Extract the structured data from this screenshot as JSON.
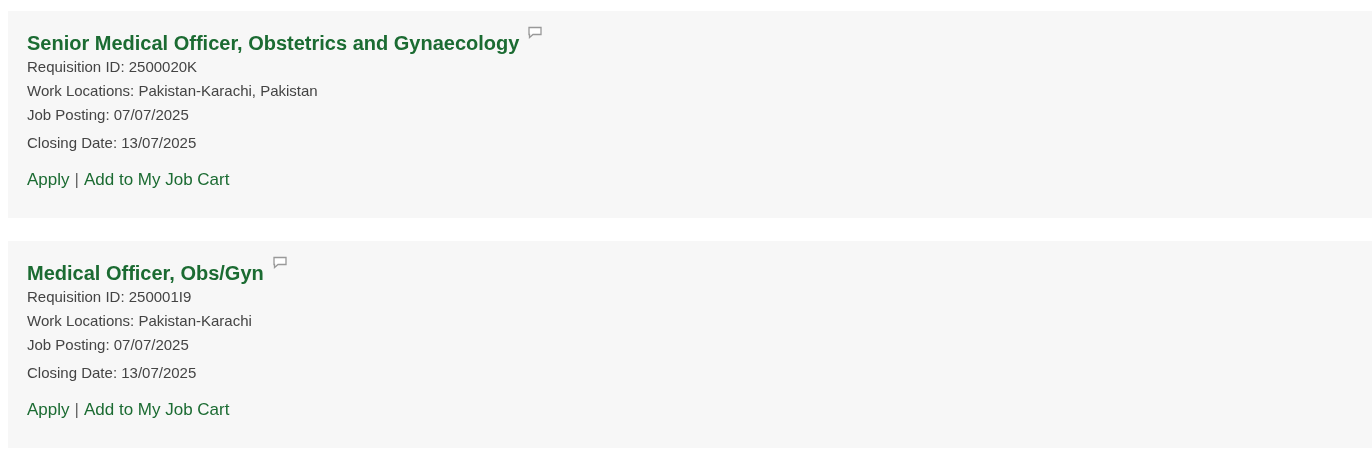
{
  "jobs": [
    {
      "title": "Senior Medical Officer, Obstetrics and Gynaecology",
      "details": [
        "Requisition ID: 2500020K",
        "Work Locations: Pakistan-Karachi, Pakistan",
        "Job Posting: 07/07/2025",
        "Closing Date: 13/07/2025"
      ],
      "links": [
        "Apply",
        "Add to My Job Cart"
      ],
      "separator": "|"
    },
    {
      "title": "Medical Officer, Obs/Gyn",
      "details": [
        "Requisition ID: 250001I9",
        "Work Locations: Pakistan-Karachi",
        "Job Posting: 07/07/2025",
        "Closing Date: 13/07/2025"
      ],
      "links": [
        "Apply",
        "Add to My Job Cart"
      ],
      "separator": "|"
    }
  ]
}
